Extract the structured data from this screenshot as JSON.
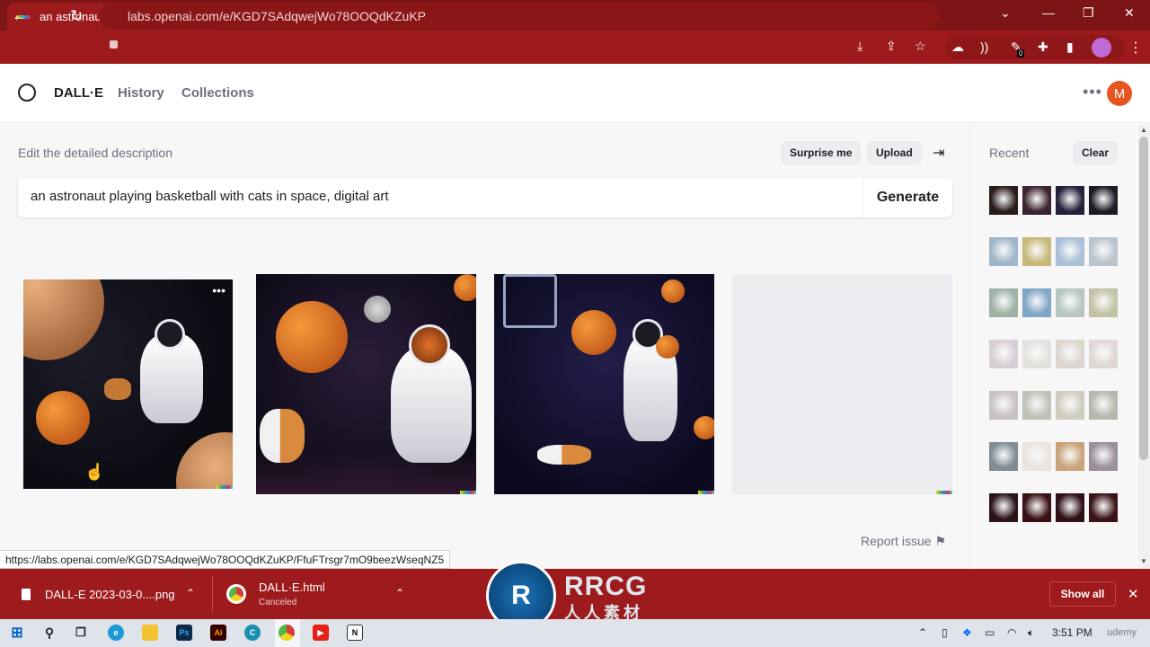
{
  "browser": {
    "tab_title": "an astronaut playing basketball w",
    "url": "labs.openai.com/e/KGD7SAdqwejWo78OOQdKZuKP",
    "extension_badge": "0"
  },
  "app": {
    "brand": "DALL·E",
    "nav": [
      "History",
      "Collections"
    ],
    "avatar_letter": "M"
  },
  "editor": {
    "label": "Edit the detailed description",
    "surprise_label": "Surprise me",
    "upload_label": "Upload",
    "prompt_value": "an astronaut playing basketball with cats in space, digital art",
    "generate_label": "Generate",
    "report_label": "Report issue"
  },
  "sidebar": {
    "title": "Recent",
    "clear_label": "Clear"
  },
  "status_url": "https://labs.openai.com/e/KGD7SAdqwejWo78OOQdKZuKP/FfuFTrsgr7mO9beezWseqNZ5",
  "downloads": [
    {
      "name": "DALL-E 2023-03-0....png",
      "status": ""
    },
    {
      "name": "DALL·E.html",
      "status": "Canceled"
    }
  ],
  "downloads_show_all": "Show all",
  "watermark": {
    "mark": "R",
    "title": "RRCG",
    "subtitle": "人人素材"
  },
  "taskbar": {
    "clock": "3:51 PM",
    "watermark_text": "udemy"
  },
  "colors": {
    "browser_chrome": "#9e1b1d",
    "app_accent": "#e8541f"
  }
}
